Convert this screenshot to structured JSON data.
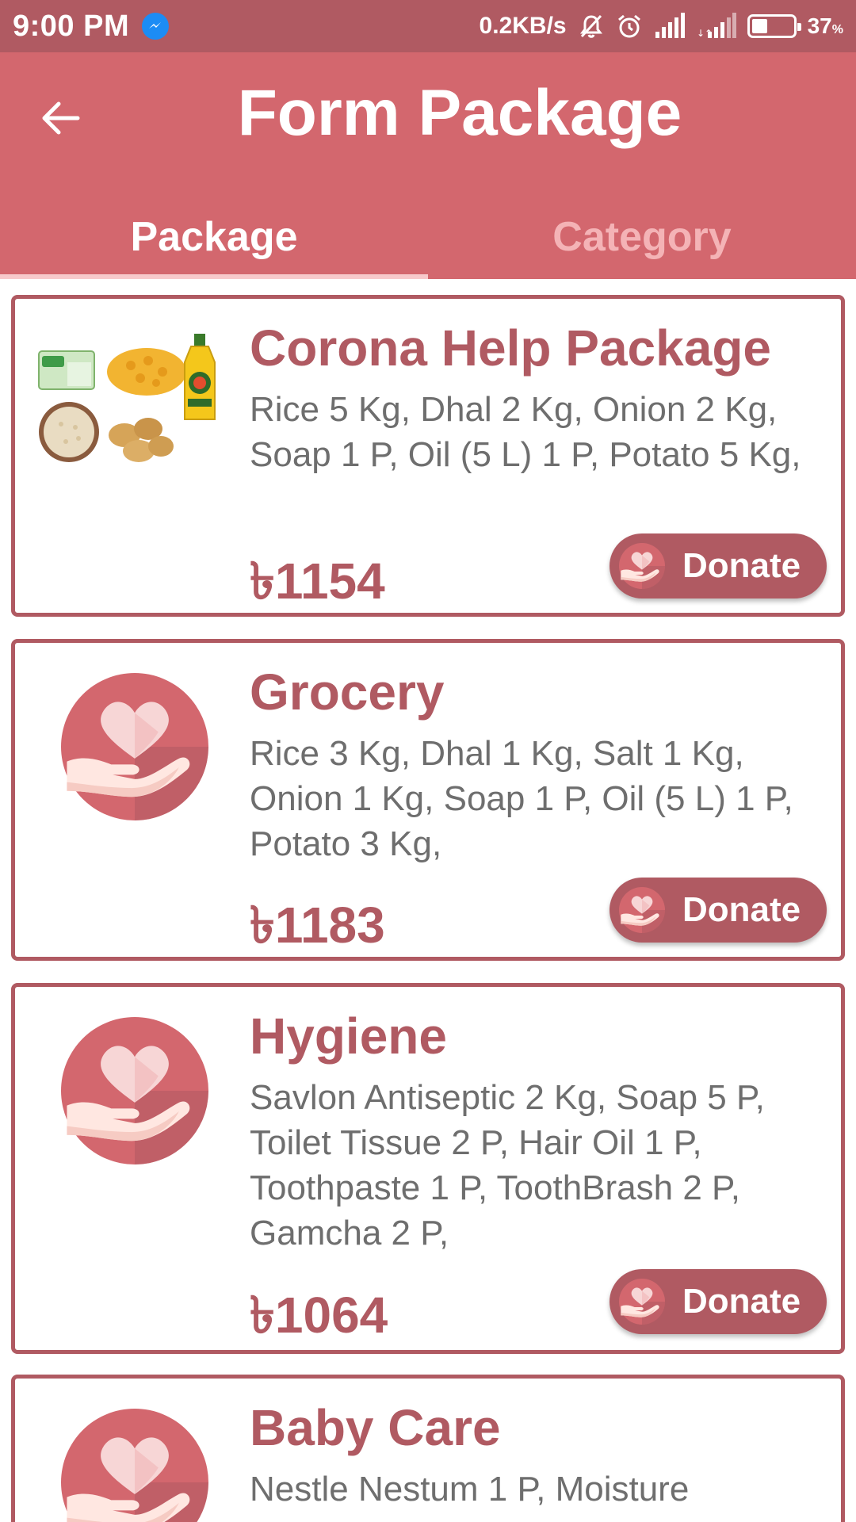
{
  "status_bar": {
    "time": "9:00 PM",
    "speed": "0.2KB/s",
    "battery_percent": "37",
    "battery_unit": "%",
    "icons": [
      "messenger-icon",
      "mute-icon",
      "alarm-icon",
      "signal-icon",
      "signal-2-icon",
      "battery-icon"
    ]
  },
  "app_bar": {
    "title": "Form Package",
    "back_icon": "arrow-left-icon"
  },
  "tabs": [
    {
      "label": "Package",
      "active": true
    },
    {
      "label": "Category",
      "active": false
    }
  ],
  "packages": [
    {
      "title": "Corona Help Package",
      "description": "Rice 5 Kg, Dhal 2 Kg, Onion 2 Kg, Soap 1 P, Oil (5 L) 1 P, Potato 5 Kg,",
      "price": "৳1154",
      "button": "Donate",
      "media": "grocery-items-image"
    },
    {
      "title": "Grocery",
      "description": "Rice 3 Kg, Dhal 1 Kg, Salt 1 Kg, Onion 1 Kg, Soap 1 P, Oil (5 L) 1 P, Potato 3 Kg,",
      "price": "৳1183",
      "button": "Donate",
      "media": "heart-hand-icon"
    },
    {
      "title": "Hygiene",
      "description": "Savlon Antiseptic 2 Kg, Soap 5 P, Toilet Tissue 2 P, Hair Oil 1 P, Toothpaste 1 P, ToothBrash 2 P, Gamcha 2 P,",
      "price": "৳1064",
      "button": "Donate",
      "media": "heart-hand-icon"
    },
    {
      "title": "Baby Care",
      "description": "Nestle Nestum 1 P, Moisture",
      "media": "heart-hand-icon"
    }
  ],
  "colors": {
    "status_bar": "#b05a62",
    "app_bar": "#d3676e",
    "accent": "#b05a62",
    "inactive_tab": "#f4b3b6"
  }
}
